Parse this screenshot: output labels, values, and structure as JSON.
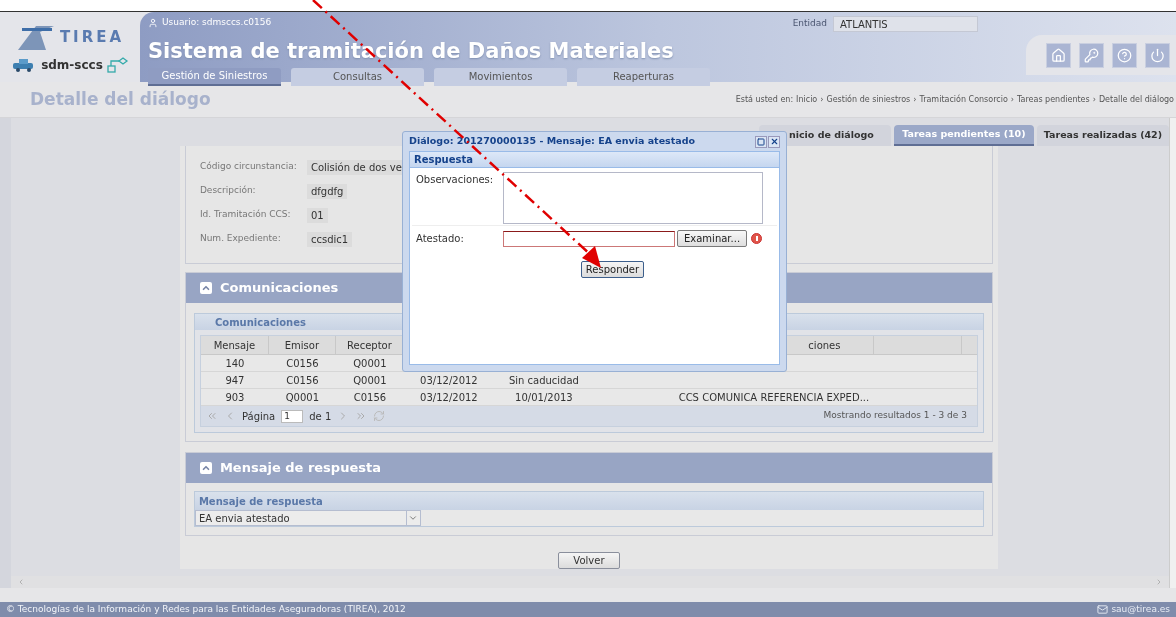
{
  "header": {
    "user": "Usuario: sdmsccs.c0156",
    "logo_text": "TIREA",
    "app_name": "sdm-sccs",
    "title": "Sistema de tramitación de Daños Materiales",
    "entity_label": "Entidad",
    "entity_value": "ATLANTIS"
  },
  "nav_tabs": [
    {
      "label": "Gestión de Siniestros",
      "selected": true
    },
    {
      "label": "Consultas",
      "selected": false
    },
    {
      "label": "Movimientos",
      "selected": false
    },
    {
      "label": "Reaperturas",
      "selected": false
    }
  ],
  "page_title": "Detalle del diálogo",
  "breadcrumb": {
    "prefix": "Está usted en:",
    "separator": "›",
    "items": [
      "Inicio",
      "Gestión de siniestros",
      "Tramitación Consorcio",
      "Tareas pendientes",
      "Detalle del diálogo"
    ]
  },
  "tabs": [
    {
      "label": "nicio de diálogo",
      "selected": false
    },
    {
      "label": "Tareas pendientes (10)",
      "selected": true
    },
    {
      "label": "Tareas realizadas (42)",
      "selected": false
    }
  ],
  "details": [
    {
      "label": "Código circunstancia:",
      "value": "Colisión de dos ve"
    },
    {
      "label": "Descripción:",
      "value": "dfgdfg"
    },
    {
      "label": "Id. Tramitación CCS:",
      "value": "01"
    },
    {
      "label": "Num. Expediente:",
      "value": "ccsdic1"
    }
  ],
  "communications": {
    "title": "Comunicaciones",
    "grid_title": "Comunicaciones",
    "header": {
      "mensaje": "Mensaje",
      "emisor": "Emisor",
      "receptor": "Receptor",
      "column_6": "ciones"
    },
    "rows": [
      {
        "mensaje": "140",
        "emisor": "C0156",
        "receptor": "Q0001"
      },
      {
        "mensaje": "947",
        "emisor": "C0156",
        "receptor": "Q0001",
        "column_4": "03/12/2012",
        "column_5": "Sin caducidad"
      },
      {
        "mensaje": "903",
        "emisor": "Q0001",
        "receptor": "C0156",
        "column_4": "03/12/2012",
        "column_5": "10/01/2013",
        "column_6": "CCS COMUNICA REFERENCIA EXPED..."
      }
    ],
    "paging": {
      "page_label": "Página",
      "page_value": "1",
      "of_label": "de 1",
      "summary": "Mostrando resultados 1 - 3 de 3"
    }
  },
  "response": {
    "title": "Mensaje de respuesta",
    "grid_title": "Mensaje de respuesta",
    "value": "EA envia atestado"
  },
  "back_button": "Volver",
  "dialog": {
    "title": "Diálogo: 201270000135 - Mensaje: EA envia atestado",
    "section": "Respuesta",
    "observaciones_label": "Observaciones:",
    "atestado_label": "Atestado:",
    "browse_button": "Examinar...",
    "error": true,
    "submit_button": "Responder"
  },
  "footer": {
    "copyright": "© Tecnologías de la Información y Redes para las Entidades Aseguradoras (TIREA), 2012",
    "email": "sau@tirea.es"
  }
}
